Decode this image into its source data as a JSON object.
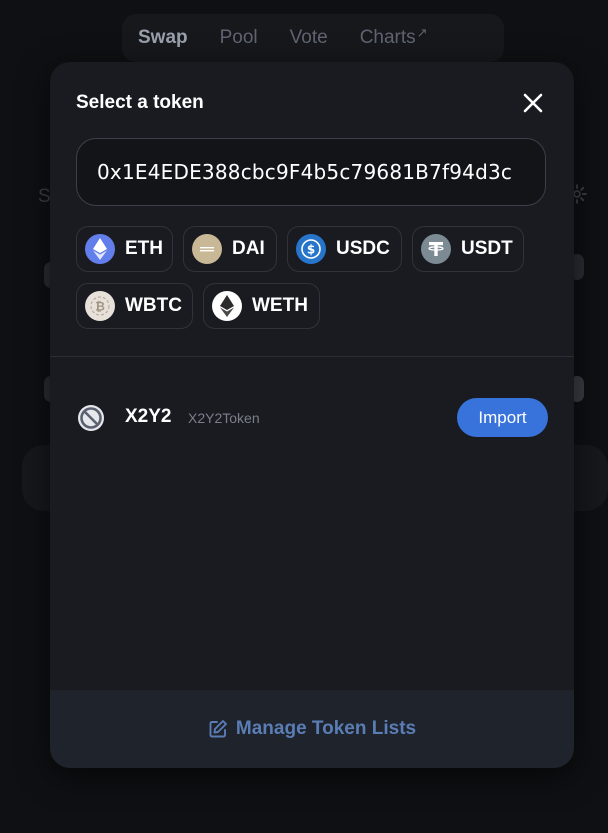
{
  "nav": {
    "items": [
      {
        "label": "Swap",
        "active": true
      },
      {
        "label": "Pool",
        "active": false
      },
      {
        "label": "Vote",
        "active": false
      },
      {
        "label": "Charts",
        "active": false,
        "external_icon": "↗"
      }
    ]
  },
  "background": {
    "partial_text": "S"
  },
  "modal": {
    "title": "Select a token",
    "search": {
      "value": "0x1E4EDE388cbc9F4b5c79681B7f94d3c",
      "placeholder": ""
    },
    "common_bases": [
      {
        "symbol": "ETH",
        "icon": "eth-icon",
        "color": "#627eea"
      },
      {
        "symbol": "DAI",
        "icon": "dai-icon",
        "color": "#c9b896"
      },
      {
        "symbol": "USDC",
        "icon": "usdc-icon",
        "color": "#2775ca"
      },
      {
        "symbol": "USDT",
        "icon": "usdt-icon",
        "color": "#7c8a94"
      },
      {
        "symbol": "WBTC",
        "icon": "wbtc-icon",
        "color": "#d8d2cb"
      },
      {
        "symbol": "WETH",
        "icon": "weth-icon",
        "color": "#ffffff"
      }
    ],
    "results": [
      {
        "symbol": "X2Y2",
        "name": "X2Y2Token",
        "icon": "blocked-token-icon",
        "action": "Import"
      }
    ],
    "footer": {
      "manage_label": "Manage Token Lists"
    }
  },
  "colors": {
    "accent": "#3773da",
    "link": "#5a7db5",
    "modal_bg": "#191b20"
  }
}
